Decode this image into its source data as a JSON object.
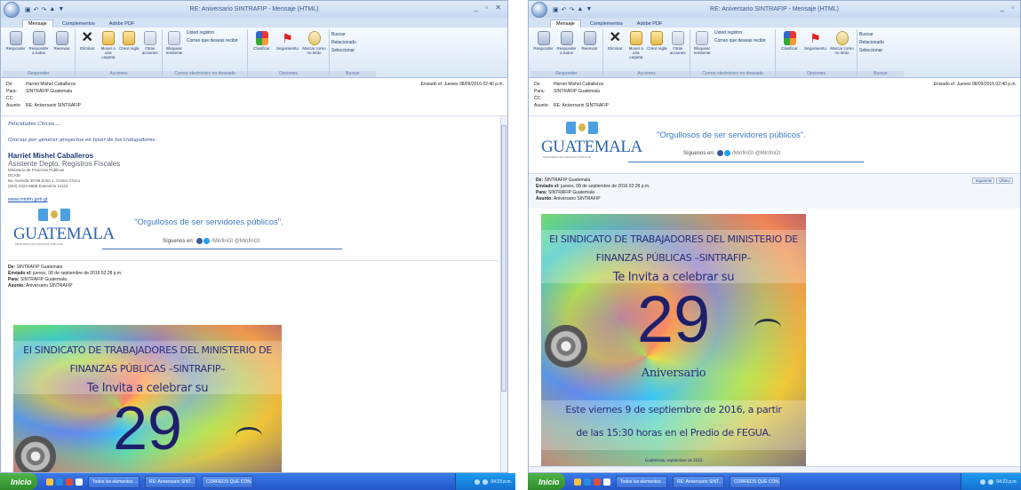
{
  "title": "RE: Aniversario SINTRAFIP - Mensaje (HTML)",
  "tabs": [
    "Mensaje",
    "Complementos",
    "Adobe PDF"
  ],
  "ribbon": {
    "responder": {
      "labels": [
        "Responder",
        "Responder a todos",
        "Reenviar"
      ],
      "group": "Responder"
    },
    "acciones": {
      "labels": [
        "Eliminar",
        "Mover a una carpeta",
        "Crear regla",
        "Otras acciones"
      ],
      "group": "Acciones"
    },
    "correo": {
      "bloquear": "Bloquear remitente",
      "label": "Correo electrónico no deseado",
      "usted": "Usted registro",
      "correo_nd": "Correo que deseas recibir"
    },
    "opciones": {
      "labels": [
        "Clasificar",
        "Seguimiento",
        "Marcar como no leído"
      ],
      "group": "Opciones"
    },
    "buscar": {
      "items": [
        "Buscar",
        "Relacionado",
        "Seleccionar"
      ],
      "group": "Buscar"
    }
  },
  "header": {
    "de_label": "De:",
    "de": "Harriet Mishel Caballeros",
    "para_label": "Para:",
    "para": "SINTRAFIP Guatemala",
    "cc_label": "CC:",
    "asunto_label": "Asunto:",
    "asunto": "RE: Aniversario SINTRAFIP",
    "enviado_label": "Enviado el:",
    "enviado": "Jueves 08/09/2016 02:40 p.m."
  },
  "body": {
    "greet": "Felicidades Chicos….",
    "thanks": "Gracias por generar proyectos en favor de los trabajadores.",
    "sig": {
      "name": "Harriet Mishel Caballeros",
      "role": "Asistente Depto. Registros Fiscales",
      "org": "Ministerio de Finanzas Públicas",
      "dept": "DCABI",
      "addr": "8a. Avenida 20-59 Zona 1, Centro Cívico",
      "phone": "(502) 2322-8888 Extensión 11122",
      "url": "www.minfin.gob.gt"
    },
    "banner": {
      "guatemala": "GUATEMALA",
      "sub": "MINISTERIO DE FINANZAS PÚBLICAS",
      "orgullosos": "\"Orgullosos de ser servidores públicos\".",
      "siguenos": "Síguenos en:",
      "handle": "/MinfinGt @MinfinGt"
    },
    "fwd": {
      "de_label": "De:",
      "de": "SINTRAFIP Guatemala",
      "enviado_label": "Enviado el:",
      "enviado": "jueves, 08 de septiembre de 2016 02:28 p.m.",
      "para_label": "Para:",
      "para": "SINTRAFIP Guatemala",
      "asunto_label": "Asunto:",
      "asunto": "Aniversario SINTRAFIP"
    },
    "poster": {
      "line1": "EI SINDICATO DE TRABAJADORES DEL MINISTERIO DE",
      "line2": "FINANZAS PÚBLICAS –SINTRAFIP–",
      "line3": "Te Invita a celebrar su",
      "num": "29",
      "aniv": "Aniversario",
      "line4": "Este viernes 9 de septiembre de 2016, a partir",
      "line5": "de las 15:30 horas en el Predio de FEGUA.",
      "foot": "Guatemala, septiembre de 2016"
    }
  },
  "nav2": [
    "Siguiente",
    "Último"
  ],
  "taskbar": {
    "start": "Inicio",
    "tasks": [
      "Todos los elementos ...",
      "RE: Aniversario SINT...",
      "CORREOS QUE CON..."
    ],
    "clock": "04:23 p.m."
  }
}
